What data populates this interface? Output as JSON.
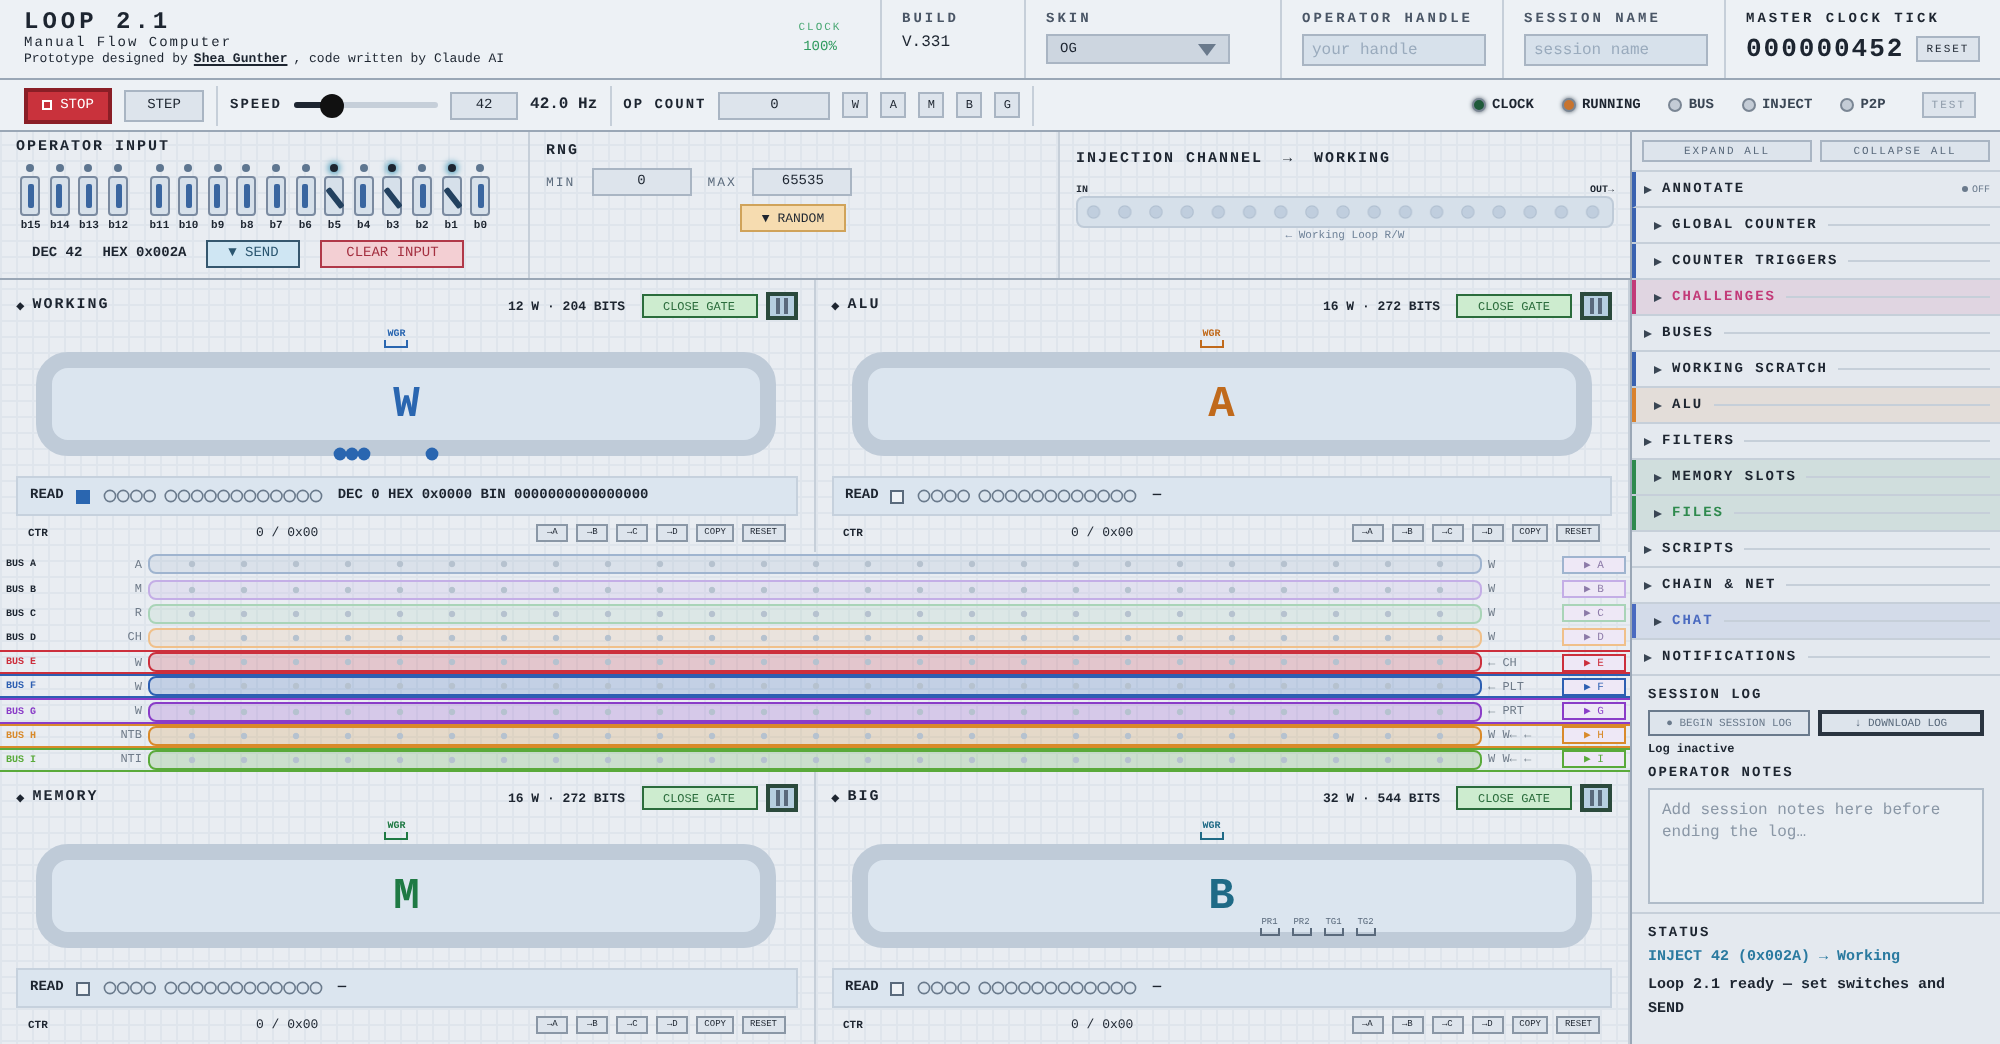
{
  "header": {
    "title": "LOOP 2.1",
    "subtitle": "Manual Flow Computer",
    "credit_prefix": "Prototype designed by",
    "credit_link": "Shea Gunther",
    "credit_suffix": ", code written by Claude AI",
    "clock_label": "CLOCK",
    "clock_value": "100%",
    "build_label": "BUILD",
    "build_value": "V.331",
    "skin_label": "SKIN",
    "skin_value": "OG",
    "handle_label": "OPERATOR HANDLE",
    "handle_placeholder": "your handle",
    "session_label": "SESSION NAME",
    "session_placeholder": "session name",
    "tick_label": "MASTER CLOCK TICK",
    "tick_value": "000000452",
    "reset": "RESET"
  },
  "toolbar": {
    "stop": "STOP",
    "step": "STEP",
    "speed_label": "SPEED",
    "speed": {
      "level": 0.27
    },
    "speed_value": "42",
    "speed_hz": "42.0 Hz",
    "opcount_label": "OP COUNT",
    "opcount_value": "0",
    "loop_buttons": [
      "W",
      "A",
      "M",
      "B",
      "G"
    ],
    "indicators": [
      {
        "label": "CLOCK",
        "on": true,
        "color": "#1f5a3a"
      },
      {
        "label": "RUNNING",
        "on": true,
        "color": "#c8742e"
      },
      {
        "label": "BUS",
        "on": false,
        "color": "#c4ccd6"
      },
      {
        "label": "INJECT",
        "on": false,
        "color": "#c4ccd6"
      },
      {
        "label": "P2P",
        "on": false,
        "color": "#c4ccd6"
      }
    ],
    "test": {
      "label": "TEST",
      "disabled": true
    }
  },
  "operator": {
    "title": "OPERATOR INPUT",
    "switches": [
      {
        "label": "b15",
        "on": false
      },
      {
        "label": "b14",
        "on": false
      },
      {
        "label": "b13",
        "on": false
      },
      {
        "label": "b12",
        "on": false
      },
      {
        "label": "b11",
        "on": false
      },
      {
        "label": "b10",
        "on": false
      },
      {
        "label": "b9",
        "on": false
      },
      {
        "label": "b8",
        "on": false
      },
      {
        "label": "b7",
        "on": false
      },
      {
        "label": "b6",
        "on": false
      },
      {
        "label": "b5",
        "on": true
      },
      {
        "label": "b4",
        "on": false
      },
      {
        "label": "b3",
        "on": true
      },
      {
        "label": "b2",
        "on": false
      },
      {
        "label": "b1",
        "on": true
      },
      {
        "label": "b0",
        "on": false
      }
    ],
    "dec": "DEC 42",
    "hex": "HEX 0x002A",
    "send": "▼ SEND",
    "clear": "CLEAR INPUT"
  },
  "rng": {
    "title": "RNG",
    "min_label": "MIN",
    "min": "0",
    "max_label": "MAX",
    "max": "65535",
    "random": "▼ RANDOM"
  },
  "injection": {
    "title": "INJECTION CHANNEL",
    "arrow": "→",
    "target": "WORKING",
    "in": "IN",
    "out": "OUT→",
    "caption": "← Working Loop R/W"
  },
  "panels_top": [
    {
      "bullet": "◆",
      "name": "WORKING",
      "size": "12 W · 204 BITS",
      "gate": "CLOSE GATE",
      "port": "WGR",
      "letter": "W",
      "color": "#2a66b0",
      "active": true,
      "read_label": "READ",
      "read": true,
      "readout": "DEC 0 HEX 0x0000 BIN 0000000000000000",
      "ctr_label": "CTR",
      "ctr": "0 / 0x00",
      "actions": [
        "→A",
        "→B",
        "→C",
        "→D",
        "COPY",
        "RESET"
      ]
    },
    {
      "bullet": "◆",
      "name": "ALU",
      "size": "16 W · 272 BITS",
      "gate": "CLOSE GATE",
      "port": "WGR",
      "letter": "A",
      "color": "#c06a1c",
      "active": false,
      "read_label": "READ",
      "read": false,
      "readout": "—",
      "ctr_label": "CTR",
      "ctr": "0 / 0x00",
      "actions": [
        "→A",
        "→B",
        "→C",
        "→D",
        "COPY",
        "RESET"
      ]
    }
  ],
  "buses": [
    {
      "name": "BUS A",
      "kind": "loop",
      "color": "#9fb4cf",
      "left": "A",
      "right": "W",
      "button": "▶ A"
    },
    {
      "name": "BUS B",
      "kind": "loop",
      "color": "#c4aee6",
      "left": "M",
      "right": "W",
      "button": "▶ B"
    },
    {
      "name": "BUS C",
      "kind": "loop",
      "color": "#a9d4b8",
      "left": "R",
      "right": "W",
      "button": "▶ C"
    },
    {
      "name": "BUS D",
      "kind": "loop",
      "color": "#f0c08a",
      "left": "CH",
      "right": "W",
      "button": "▶ D"
    },
    {
      "name": "BUS E",
      "kind": "line",
      "color": "#cc2f3c",
      "left": "W",
      "right": "← CH",
      "button": "▶ E"
    },
    {
      "name": "BUS F",
      "kind": "line",
      "color": "#2d5fb2",
      "left": "W",
      "right": "← PLT",
      "button": "▶ F"
    },
    {
      "name": "BUS G",
      "kind": "line",
      "color": "#8a3cc8",
      "left": "W",
      "right": "← PRT",
      "button": "▶ G"
    },
    {
      "name": "BUS H",
      "kind": "line",
      "color": "#d98a2a",
      "left": "NTB",
      "right": "W W← ←",
      "button": "▶ H"
    },
    {
      "name": "BUS I",
      "kind": "line",
      "color": "#5aaa3a",
      "left": "NTI",
      "right": "W W← ←",
      "button": "▶ I"
    }
  ],
  "panels_bottom": [
    {
      "bullet": "◆",
      "name": "MEMORY",
      "size": "16 W · 272 BITS",
      "gate": "CLOSE GATE",
      "port": "WGR",
      "letter": "M",
      "color": "#1f7a44",
      "active": false,
      "read_label": "READ",
      "read": false,
      "readout": "—",
      "ctr_label": "CTR",
      "ctr": "0 / 0x00",
      "actions": [
        "→A",
        "→B",
        "→C",
        "→D",
        "COPY",
        "RESET"
      ]
    },
    {
      "bullet": "◆",
      "name": "BIG",
      "size": "32 W · 544 BITS",
      "gate": "CLOSE GATE",
      "port": "WGR",
      "letter": "B",
      "color": "#1f6a86",
      "active": false,
      "markers": [
        "PR1",
        "PR2",
        "TG1",
        "TG2"
      ],
      "read_label": "READ",
      "read": false,
      "readout": "—",
      "ctr_label": "CTR",
      "ctr": "0 / 0x00",
      "actions": [
        "→A",
        "→B",
        "→C",
        "→D",
        "COPY",
        "RESET"
      ]
    }
  ],
  "sidebar": {
    "expand": "EXPAND ALL",
    "collapse": "COLLAPSE ALL",
    "annotate": {
      "label": "ANNOTATE",
      "toggle": "OFF",
      "on": false,
      "expanded": false
    },
    "sections": [
      {
        "label": "GLOBAL COUNTER",
        "expanded": false,
        "kind": "accent",
        "color": "#3a62b0"
      },
      {
        "label": "COUNTER TRIGGERS",
        "expanded": false,
        "kind": "accent",
        "color": "#3a62b0"
      },
      {
        "label": "CHALLENGES",
        "expanded": false,
        "kind": "tinted",
        "color": "#c23a78"
      },
      {
        "label": "BUSES",
        "expanded": false,
        "kind": "plain"
      },
      {
        "label": "WORKING SCRATCH",
        "expanded": false,
        "kind": "accent",
        "color": "#3a62b0"
      },
      {
        "label": "ALU",
        "expanded": false,
        "kind": "shaded",
        "color": "#d9822e"
      },
      {
        "label": "FILTERS",
        "expanded": false,
        "kind": "plain"
      },
      {
        "label": "MEMORY SLOTS",
        "expanded": false,
        "kind": "shaded",
        "color": "#2f8a4e"
      },
      {
        "label": "FILES",
        "expanded": false,
        "kind": "tinted",
        "color": "#2f8a4e"
      },
      {
        "label": "SCRIPTS",
        "expanded": false,
        "kind": "plain"
      },
      {
        "label": "CHAIN & NET",
        "expanded": false,
        "kind": "plain"
      },
      {
        "label": "CHAT",
        "expanded": false,
        "kind": "tinted",
        "color": "#4a6ac0"
      },
      {
        "label": "NOTIFICATIONS",
        "expanded": false,
        "kind": "plain"
      }
    ],
    "log_title": "SESSION LOG",
    "begin": "● BEGIN SESSION LOG",
    "download": "↓ DOWNLOAD LOG",
    "log_state": "Log inactive",
    "notes_title": "OPERATOR NOTES",
    "notes_placeholder": "Add session notes here before ending the log…",
    "status_title": "STATUS",
    "status": [
      {
        "kind": "inject",
        "text": "INJECT 42 (0x002A) → Working"
      },
      {
        "kind": "info",
        "text": "Loop 2.1 ready — set switches and SEND"
      }
    ]
  }
}
